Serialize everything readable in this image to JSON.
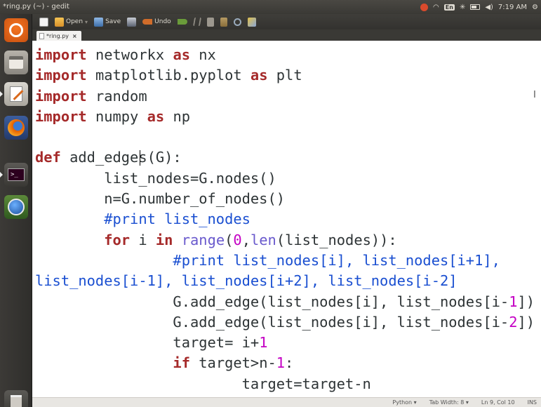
{
  "window": {
    "title": "*ring.py (~) - gedit"
  },
  "panel": {
    "time": "7:19 AM",
    "keyboard_layout": "En"
  },
  "toolbar": {
    "open_label": "Open",
    "save_label": "Save",
    "undo_label": "Undo"
  },
  "tab": {
    "label": "*ring.py",
    "close_glyph": "×"
  },
  "editor": {
    "lines": [
      [
        {
          "t": "import",
          "c": "kw"
        },
        {
          "t": " networkx ",
          "c": "pl"
        },
        {
          "t": "as",
          "c": "kw"
        },
        {
          "t": " nx",
          "c": "pl"
        }
      ],
      [
        {
          "t": "import",
          "c": "kw"
        },
        {
          "t": " matplotlib.pyplot ",
          "c": "pl"
        },
        {
          "t": "as",
          "c": "kw"
        },
        {
          "t": " plt",
          "c": "pl"
        }
      ],
      [
        {
          "t": "import",
          "c": "kw"
        },
        {
          "t": " random",
          "c": "pl"
        }
      ],
      [
        {
          "t": "import",
          "c": "kw"
        },
        {
          "t": " numpy ",
          "c": "pl"
        },
        {
          "t": "as",
          "c": "kw"
        },
        {
          "t": " np",
          "c": "pl"
        }
      ],
      [
        {
          "t": "",
          "c": "pl"
        }
      ],
      [
        {
          "t": "def",
          "c": "kw"
        },
        {
          "t": " add_edges(G):",
          "c": "pl"
        }
      ],
      [
        {
          "t": "        list_nodes=G.nodes()",
          "c": "pl"
        }
      ],
      [
        {
          "t": "        n=G.number_of_nodes()",
          "c": "pl"
        }
      ],
      [
        {
          "t": "        #print list_nodes",
          "c": "cm"
        }
      ],
      [
        {
          "t": "        ",
          "c": "pl"
        },
        {
          "t": "for",
          "c": "kw"
        },
        {
          "t": " i ",
          "c": "pl"
        },
        {
          "t": "in",
          "c": "kw"
        },
        {
          "t": " ",
          "c": "pl"
        },
        {
          "t": "range",
          "c": "bi"
        },
        {
          "t": "(",
          "c": "pl"
        },
        {
          "t": "0",
          "c": "num"
        },
        {
          "t": ",",
          "c": "pl"
        },
        {
          "t": "len",
          "c": "bi"
        },
        {
          "t": "(list_nodes)):",
          "c": "pl"
        }
      ],
      [
        {
          "t": "                #print list_nodes[i], list_nodes[i+1],",
          "c": "cm"
        }
      ],
      [
        {
          "t": "list_nodes[i-1], list_nodes[i+2], list_nodes[i-2]",
          "c": "cm"
        }
      ],
      [
        {
          "t": "                G.add_edge(list_nodes[i], list_nodes[i-",
          "c": "pl"
        },
        {
          "t": "1",
          "c": "num"
        },
        {
          "t": "])",
          "c": "pl"
        }
      ],
      [
        {
          "t": "                G.add_edge(list_nodes[i], list_nodes[i-",
          "c": "pl"
        },
        {
          "t": "2",
          "c": "num"
        },
        {
          "t": "])",
          "c": "pl"
        }
      ],
      [
        {
          "t": "                target= i+",
          "c": "pl"
        },
        {
          "t": "1",
          "c": "num"
        }
      ],
      [
        {
          "t": "                ",
          "c": "pl"
        },
        {
          "t": "if",
          "c": "kw"
        },
        {
          "t": " target>n-",
          "c": "pl"
        },
        {
          "t": "1",
          "c": "num"
        },
        {
          "t": ":",
          "c": "pl"
        }
      ],
      [
        {
          "t": "                        target=target-n",
          "c": "pl"
        }
      ]
    ]
  },
  "statusbar": {
    "language": "Python ▾",
    "tab_width": "Tab Width: 8 ▾",
    "position": "Ln 9, Col 10",
    "mode": "INS"
  }
}
